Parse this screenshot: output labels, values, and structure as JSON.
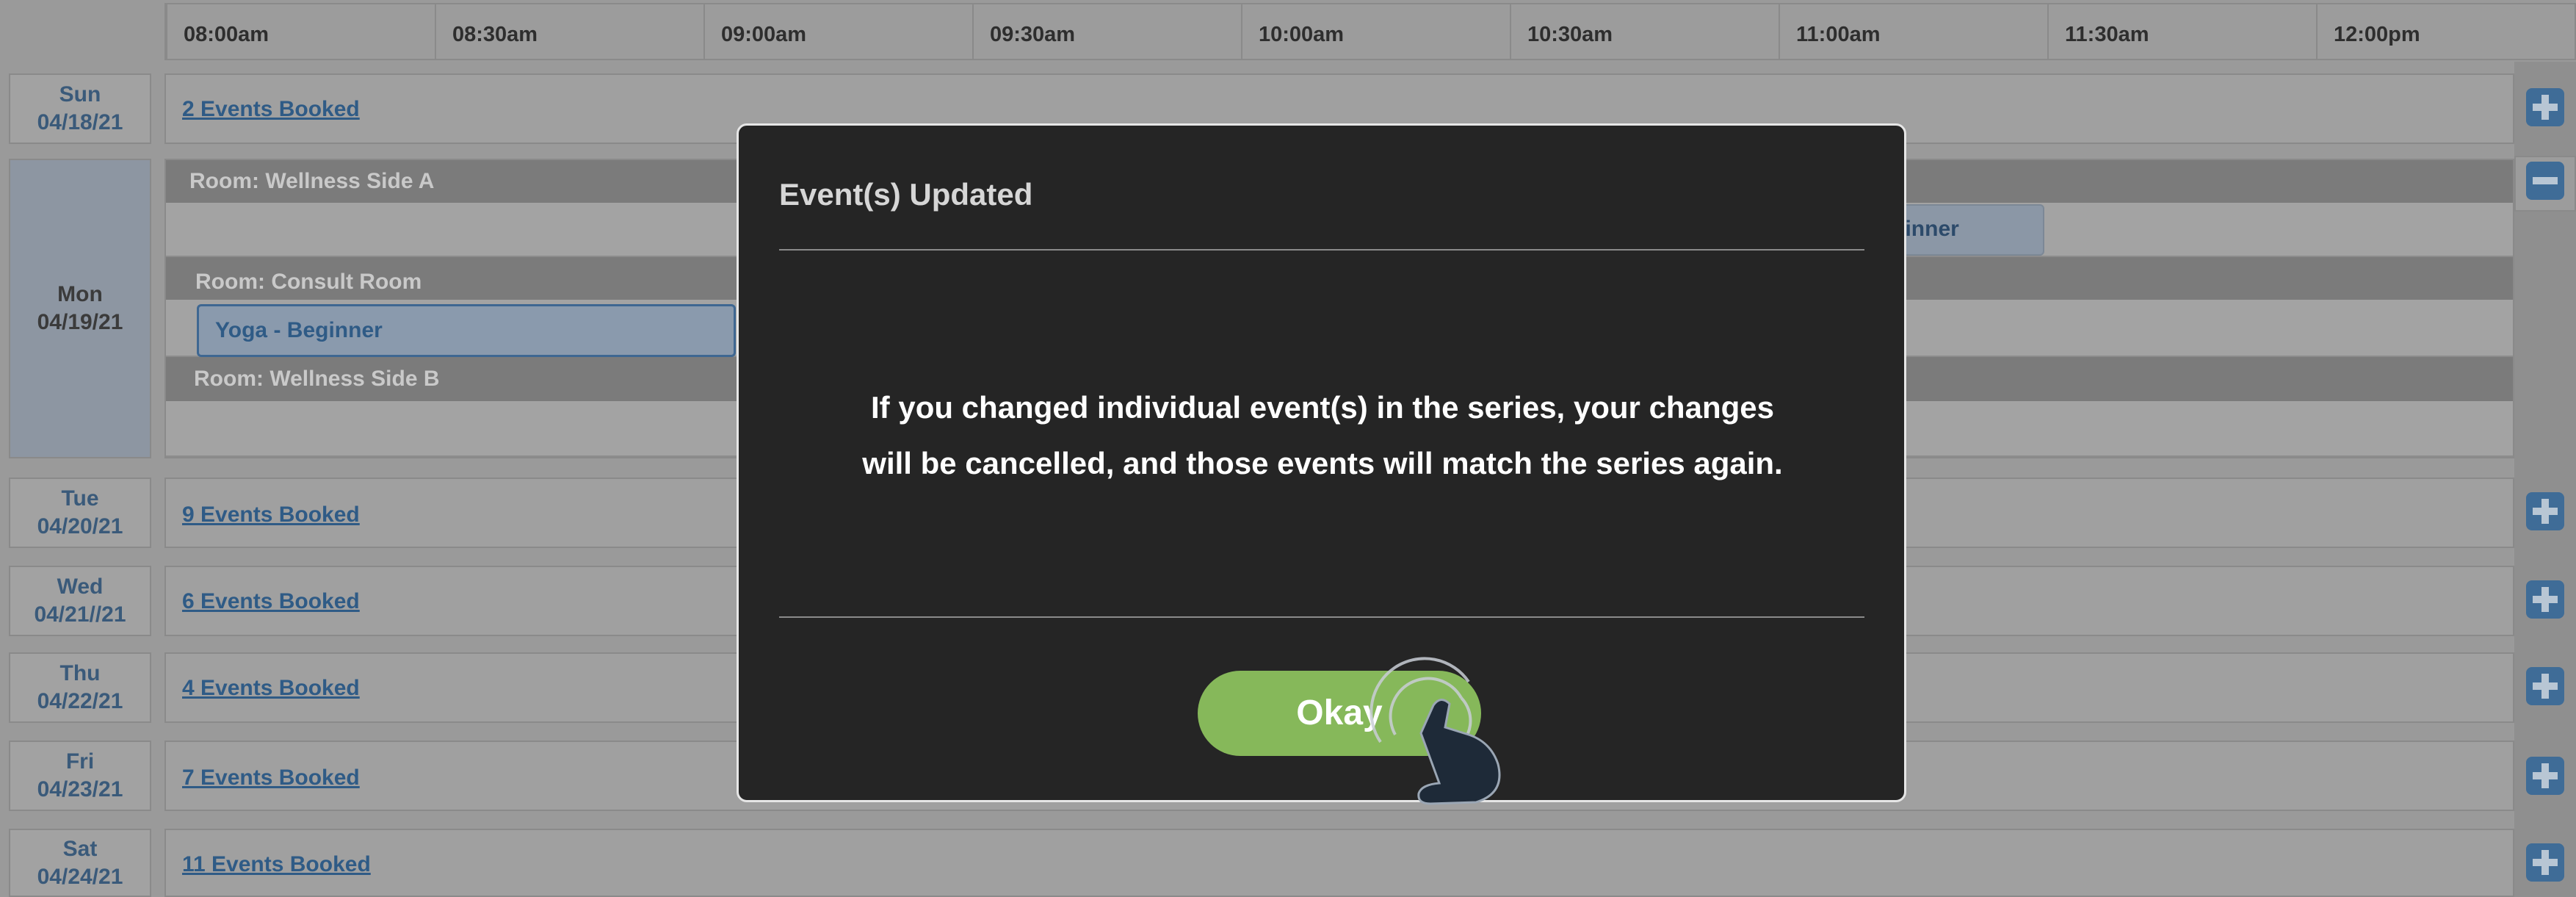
{
  "time_slots": [
    "08:00am",
    "08:30am",
    "09:00am",
    "09:30am",
    "10:00am",
    "10:30am",
    "11:00am",
    "11:30am",
    "12:00pm"
  ],
  "days": [
    {
      "dow": "Sun",
      "date": "04/18/21",
      "booked": "2 Events Booked"
    },
    {
      "dow": "Mon",
      "date": "04/19/21"
    },
    {
      "dow": "Tue",
      "date": "04/20/21",
      "booked": "9 Events Booked"
    },
    {
      "dow": "Wed",
      "date": "04/21//21",
      "booked": "6 Events Booked"
    },
    {
      "dow": "Thu",
      "date": "04/22/21",
      "booked": "4 Events Booked"
    },
    {
      "dow": "Fri",
      "date": "04/23/21",
      "booked": "7 Events Booked"
    },
    {
      "dow": "Sat",
      "date": "04/24/21",
      "booked": "11 Events Booked"
    }
  ],
  "monday_rooms": [
    {
      "label": "Room: Wellness Side A",
      "events": [
        "Yoga - Beginner"
      ]
    },
    {
      "label": "Room: Consult Room",
      "events": [
        "Yoga - Beginner"
      ]
    },
    {
      "label": "Room: Wellness Side B",
      "events": []
    }
  ],
  "modal": {
    "title": "Event(s) Updated",
    "message_line1": "If you changed individual event(s) in the series, your changes",
    "message_line2": "will be cancelled, and those events will match the series again.",
    "ok_label": "Okay"
  },
  "icons": {
    "expand": "plus-icon",
    "collapse": "minus-icon",
    "pointer": "tap-hand-icon"
  },
  "colors": {
    "accent": "#86b85a",
    "link": "#2f5b86",
    "modal_bg": "#252525",
    "overlay": "#9a9a9a"
  }
}
